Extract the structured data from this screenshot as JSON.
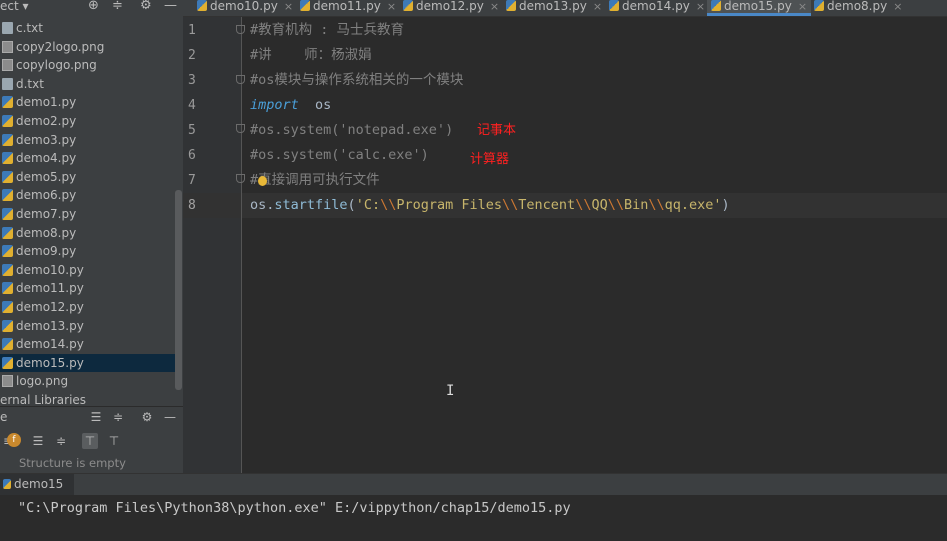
{
  "project_panel": {
    "header_label": "ect ▾",
    "files": [
      {
        "name": "c.txt",
        "type": "txt"
      },
      {
        "name": "copy2logo.png",
        "type": "img"
      },
      {
        "name": "copylogo.png",
        "type": "img"
      },
      {
        "name": "d.txt",
        "type": "txt"
      },
      {
        "name": "demo1.py",
        "type": "py"
      },
      {
        "name": "demo2.py",
        "type": "py"
      },
      {
        "name": "demo3.py",
        "type": "py"
      },
      {
        "name": "demo4.py",
        "type": "py"
      },
      {
        "name": "demo5.py",
        "type": "py"
      },
      {
        "name": "demo6.py",
        "type": "py"
      },
      {
        "name": "demo7.py",
        "type": "py"
      },
      {
        "name": "demo8.py",
        "type": "py"
      },
      {
        "name": "demo9.py",
        "type": "py"
      },
      {
        "name": "demo10.py",
        "type": "py"
      },
      {
        "name": "demo11.py",
        "type": "py"
      },
      {
        "name": "demo12.py",
        "type": "py"
      },
      {
        "name": "demo13.py",
        "type": "py"
      },
      {
        "name": "demo14.py",
        "type": "py"
      },
      {
        "name": "demo15.py",
        "type": "py",
        "selected": true
      },
      {
        "name": "logo.png",
        "type": "img"
      }
    ],
    "external_libraries": "ernal Libraries"
  },
  "structure_panel": {
    "header_label": "e",
    "empty_text": "Structure is empty"
  },
  "tabs": [
    {
      "label": "demo10.py"
    },
    {
      "label": "demo11.py"
    },
    {
      "label": "demo12.py"
    },
    {
      "label": "demo13.py"
    },
    {
      "label": "demo14.py"
    },
    {
      "label": "demo15.py",
      "active": true
    },
    {
      "label": "demo8.py"
    }
  ],
  "editor": {
    "line_numbers": [
      "1",
      "2",
      "3",
      "4",
      "5",
      "6",
      "7",
      "8"
    ],
    "lines": {
      "l1": "#教育机构 : 马士兵教育",
      "l2": "#讲    师：杨淑娟",
      "l3": "#os模块与操作系统相关的一个模块",
      "l4_kw": "import",
      "l4_rest": "  os",
      "l5": "#os.system('notepad.exe')",
      "l6": "#os.system('calc.exe')",
      "l7": "#直接调用可执行文件",
      "l8_obj": "os.",
      "l8_fn": "startfile",
      "l8_open": "(",
      "l8_s1": "'C:",
      "l8_e1": "\\\\",
      "l8_s2": "Program Files",
      "l8_e2": "\\\\",
      "l8_s3": "Tencent",
      "l8_e3": "\\\\",
      "l8_s4": "QQ",
      "l8_e4": "\\\\",
      "l8_s5": "Bin",
      "l8_e5": "\\\\",
      "l8_s6": "qq.exe'",
      "l8_close": ")"
    },
    "annotations": {
      "notepad": "记事本",
      "calculator": "计算器"
    }
  },
  "run_panel": {
    "tab_label": "demo15",
    "command": "\"C:\\Program Files\\Python38\\python.exe\" E:/vippython/chap15/demo15.py"
  },
  "colors": {
    "annotation": "#ff2020",
    "selection": "#0d293e",
    "tab_active_underline": "#4a88c7"
  }
}
